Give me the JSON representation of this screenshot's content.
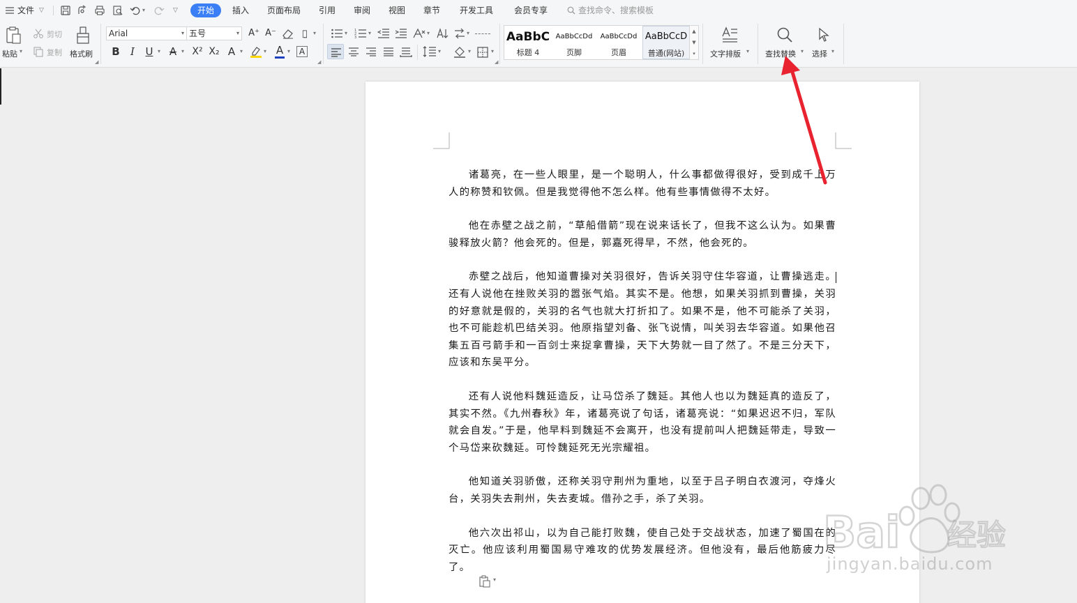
{
  "menubar": {
    "file_label": "文件",
    "tabs": [
      "开始",
      "插入",
      "页面布局",
      "引用",
      "审阅",
      "视图",
      "章节",
      "开发工具",
      "会员专享"
    ],
    "search_placeholder": "查找命令、搜索模板"
  },
  "ribbon": {
    "paste": "粘贴",
    "cut": "剪切",
    "copy": "复制",
    "format_painter": "格式刷",
    "font_name": "Arial",
    "font_size": "五号",
    "styles": [
      {
        "preview": "AaBbC",
        "name": "标题 4"
      },
      {
        "preview": "AaBbCcDd",
        "name": "页脚"
      },
      {
        "preview": "AaBbCcDd",
        "name": "页眉"
      },
      {
        "preview": "AaBbCcD",
        "name": "普通(网站)"
      }
    ],
    "text_layout": "文字排版",
    "find_replace": "查找替换",
    "select": "选择"
  },
  "document": {
    "paragraphs": [
      "诸葛亮，在一些人眼里，是一个聪明人，什么事都做得很好，受到成千上万人的称赞和钦佩。但是我觉得他不怎么样。他有些事情做得不太好。",
      "他在赤壁之战之前，“草船借箭”现在说来话长了，但我不这么认为。如果曹骏释放火箭？他会死的。但是，郭嘉死得早，不然，他会死的。",
      "赤壁之战后，他知道曹操对关羽很好，告诉关羽守住华容道，让曹操逃走。还有人说他在挫败关羽的嚣张气焰。其实不是。他想，如果关羽抓到曹操，关羽的好意就是假的，关羽的名气也就大打折扣了。如果不是，他不可能杀了关羽，也不可能趁机巴结关羽。他原指望刘备、张飞说情，叫关羽去华容道。如果他召集五百弓箭手和一百剑士来捉拿曹操，天下大势就一目了然了。不是三分天下，应该和东吴平分。",
      "还有人说他料魏延造反，让马岱杀了魏延。其他人也以为魏延真的造反了，其实不然。《九州春秋》年，诸葛亮说了句话，诸葛亮说：“如果迟迟不归，军队就会自发。”于是，他早料到魏延不会离开，也没有提前叫人把魏延带走，导致一个马岱来砍魏延。可怜魏延死无光宗耀祖。",
      "他知道关羽骄傲，还称关羽守荆州为重地，以至于吕子明白衣渡河，夺烽火台，关羽失去荆州，失去麦城。借孙之手，杀了关羽。",
      "他六次出祁山，以为自己能打败魏，使自己处于交战状态，加速了蜀国在的灭亡。他应该利用蜀国易守难攻的优势发展经济。但他没有，最后他筋疲力尽了。"
    ]
  },
  "watermark": {
    "brand": "Bai",
    "brand_suffix": "经验",
    "url": "jingyan.baidu.com"
  },
  "colors": {
    "accent": "#3a7ff5",
    "arrow": "#e8232f",
    "highlight": "#ffd700",
    "font_color": "#1c3fbf"
  }
}
